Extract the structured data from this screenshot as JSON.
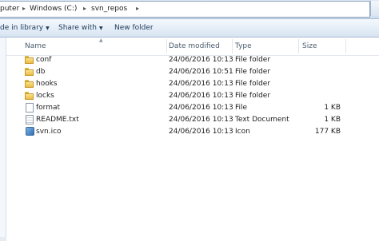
{
  "breadcrumb": {
    "items": [
      "puter",
      "Windows (C:)",
      "svn_repos"
    ]
  },
  "toolbar": {
    "include_label": "de in library",
    "share_label": "Share with",
    "new_folder_label": "New folder"
  },
  "columns": {
    "name": "Name",
    "date": "Date modified",
    "type": "Type",
    "size": "Size"
  },
  "files": [
    {
      "name": "conf",
      "date": "24/06/2016 10:13",
      "type": "File folder",
      "size": "",
      "icon": "folder-icon"
    },
    {
      "name": "db",
      "date": "24/06/2016 10:51",
      "type": "File folder",
      "size": "",
      "icon": "folder-icon"
    },
    {
      "name": "hooks",
      "date": "24/06/2016 10:13",
      "type": "File folder",
      "size": "",
      "icon": "folder-icon"
    },
    {
      "name": "locks",
      "date": "24/06/2016 10:13",
      "type": "File folder",
      "size": "",
      "icon": "folder-icon"
    },
    {
      "name": "format",
      "date": "24/06/2016 10:13",
      "type": "File",
      "size": "1 KB",
      "icon": "file-icon"
    },
    {
      "name": "README.txt",
      "date": "24/06/2016 10:13",
      "type": "Text Document",
      "size": "1 KB",
      "icon": "text-file-icon"
    },
    {
      "name": "svn.ico",
      "date": "24/06/2016 10:13",
      "type": "Icon",
      "size": "177 KB",
      "icon": "ico-file-icon"
    }
  ]
}
